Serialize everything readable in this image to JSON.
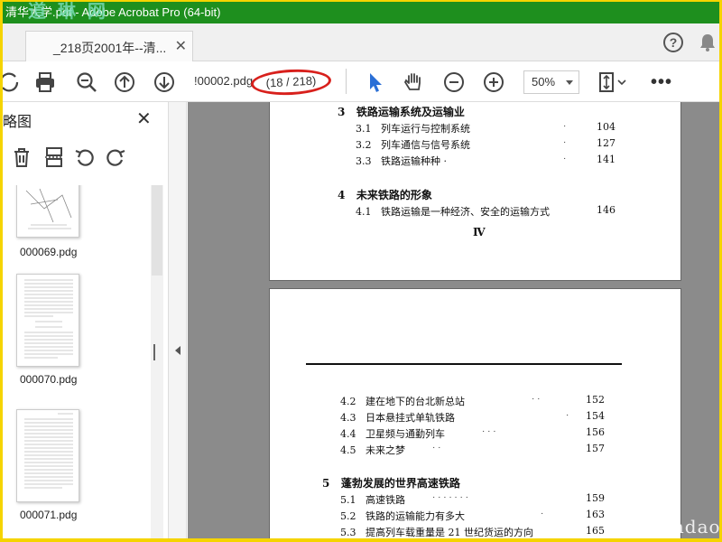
{
  "titlebar": {
    "title": "清华大学.pdf - Adobe Acrobat Pro (64-bit)",
    "watermark": "道 琳 网"
  },
  "tab": {
    "label": "_218页2001年--清...",
    "close": "✕"
  },
  "header": {
    "help": "?",
    "bell_icon": "bell-icon"
  },
  "toolbar": {
    "filename": "!00002.pdg",
    "page_indicator": "(18 / 218)",
    "zoom": "50%",
    "more": "•••"
  },
  "panel": {
    "title": "略图",
    "close": "✕"
  },
  "thumbnails": [
    {
      "label": "000069.pdg"
    },
    {
      "label": "000070.pdg"
    },
    {
      "label": "000071.pdg"
    }
  ],
  "page1": {
    "chapters": [
      {
        "num": "3",
        "title": "铁路运输系统及运输业"
      },
      {
        "num": "4",
        "title": "未来铁路的形象"
      }
    ],
    "sections": [
      {
        "num": "3.1",
        "title": "列车运行与控制系统",
        "dots": "·",
        "page": "104"
      },
      {
        "num": "3.2",
        "title": "列车通信与信号系统",
        "dots": "·",
        "page": "127"
      },
      {
        "num": "3.3",
        "title": "铁路运输种种 ·",
        "dots": "·",
        "page": "141"
      },
      {
        "num": "4.1",
        "title": "铁路运输是一种经济、安全的运输方式",
        "dots": "",
        "page": "146"
      }
    ],
    "roman": "Ⅳ"
  },
  "page2": {
    "sections_a": [
      {
        "num": "4.2",
        "title": "建在地下的台北新总站",
        "dots": "·        ·",
        "page": "152"
      },
      {
        "num": "4.3",
        "title": "日本悬挂式单轨铁路",
        "dots": "·",
        "page": "154"
      },
      {
        "num": "4.4",
        "title": "卫星频与通勤列车",
        "dots": "·          · ·",
        "page": "156"
      },
      {
        "num": "4.5",
        "title": "未来之梦",
        "dots": "· ·",
        "page": "157"
      }
    ],
    "chapter": {
      "num": "5",
      "title": "蓬勃发展的世界高速铁路"
    },
    "sections_b": [
      {
        "num": "5.1",
        "title": "高速铁路",
        "dots": "·     · ·   · ·  · ·",
        "page": "159"
      },
      {
        "num": "5.2",
        "title": "铁路的运输能力有多大",
        "dots": "·",
        "page": "163"
      },
      {
        "num": "5.3",
        "title": "提高列车载重量是 21 世纪货运的方向",
        "dots": "",
        "page": "165"
      }
    ]
  },
  "watermark_bottom": "www. cndao."
}
